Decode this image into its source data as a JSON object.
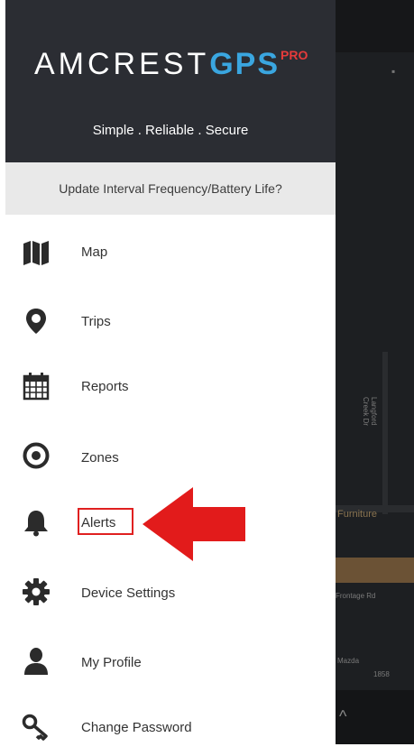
{
  "header": {
    "logo": {
      "main": "AMCREST",
      "accent": "GPS",
      "suffix": "PRO"
    },
    "tagline": "Simple . Reliable . Secure"
  },
  "update_bar": {
    "label": "Update Interval Frequency/Battery Life?"
  },
  "menu": [
    {
      "label": "Map",
      "icon": "map-icon"
    },
    {
      "label": "Trips",
      "icon": "map-pin-icon"
    },
    {
      "label": "Reports",
      "icon": "calendar-icon"
    },
    {
      "label": "Zones",
      "icon": "target-icon"
    },
    {
      "label": "Alerts",
      "icon": "bell-icon"
    },
    {
      "label": "Device Settings",
      "icon": "gear-icon"
    },
    {
      "label": "My Profile",
      "icon": "user-icon"
    },
    {
      "label": "Change Password",
      "icon": "key-icon"
    }
  ],
  "map_labels": {
    "furniture": "Furniture",
    "frontage": "Frontage Rd",
    "mazda": "Mazda",
    "number": "1858",
    "vertical": "Langford Creek Dr"
  },
  "colors": {
    "header_bg": "#2b2d33",
    "logo_accent": "#3aa6e0",
    "logo_pro": "#e63b3b",
    "highlight_red": "#e02020"
  }
}
